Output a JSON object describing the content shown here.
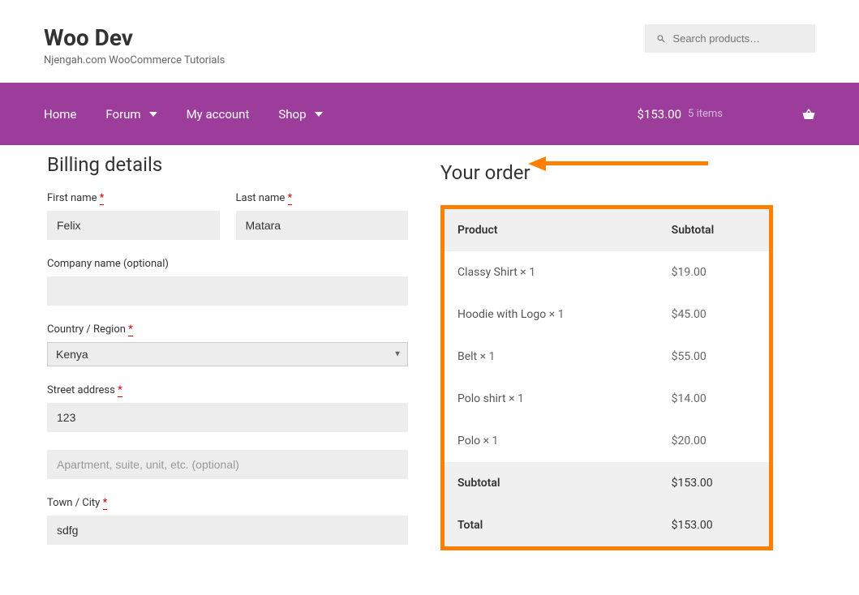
{
  "header": {
    "site_title": "Woo Dev",
    "tagline": "Njengah.com WooCommerce Tutorials",
    "search_placeholder": "Search products…"
  },
  "nav": {
    "items": [
      {
        "label": "Home",
        "has_chevron": false
      },
      {
        "label": "Forum",
        "has_chevron": true
      },
      {
        "label": "My account",
        "has_chevron": false
      },
      {
        "label": "Shop",
        "has_chevron": true
      }
    ],
    "cart_total": "$153.00",
    "cart_items": "5 items"
  },
  "billing": {
    "title": "Billing details",
    "first_name": {
      "label": "First name",
      "value": "Felix"
    },
    "last_name": {
      "label": "Last name",
      "value": "Matara"
    },
    "company": {
      "label": "Company name (optional)",
      "value": ""
    },
    "country": {
      "label": "Country / Region",
      "value": "Kenya"
    },
    "street": {
      "label": "Street address",
      "value": "123",
      "apt_placeholder": "Apartment, suite, unit, etc. (optional)",
      "apt_value": ""
    },
    "town": {
      "label": "Town / City",
      "value": "sdfg"
    }
  },
  "order": {
    "title": "Your order",
    "columns": {
      "product": "Product",
      "subtotal": "Subtotal"
    },
    "items": [
      {
        "name": "Classy Shirt",
        "qty": "× 1",
        "price": "$19.00"
      },
      {
        "name": "Hoodie with Logo",
        "qty": "× 1",
        "price": "$45.00"
      },
      {
        "name": "Belt",
        "qty": "× 1",
        "price": "$55.00"
      },
      {
        "name": "Polo shirt",
        "qty": "× 1",
        "price": "$14.00"
      },
      {
        "name": "Polo",
        "qty": "× 1",
        "price": "$20.00"
      }
    ],
    "subtotal": {
      "label": "Subtotal",
      "value": "$153.00"
    },
    "total": {
      "label": "Total",
      "value": "$153.00"
    }
  }
}
